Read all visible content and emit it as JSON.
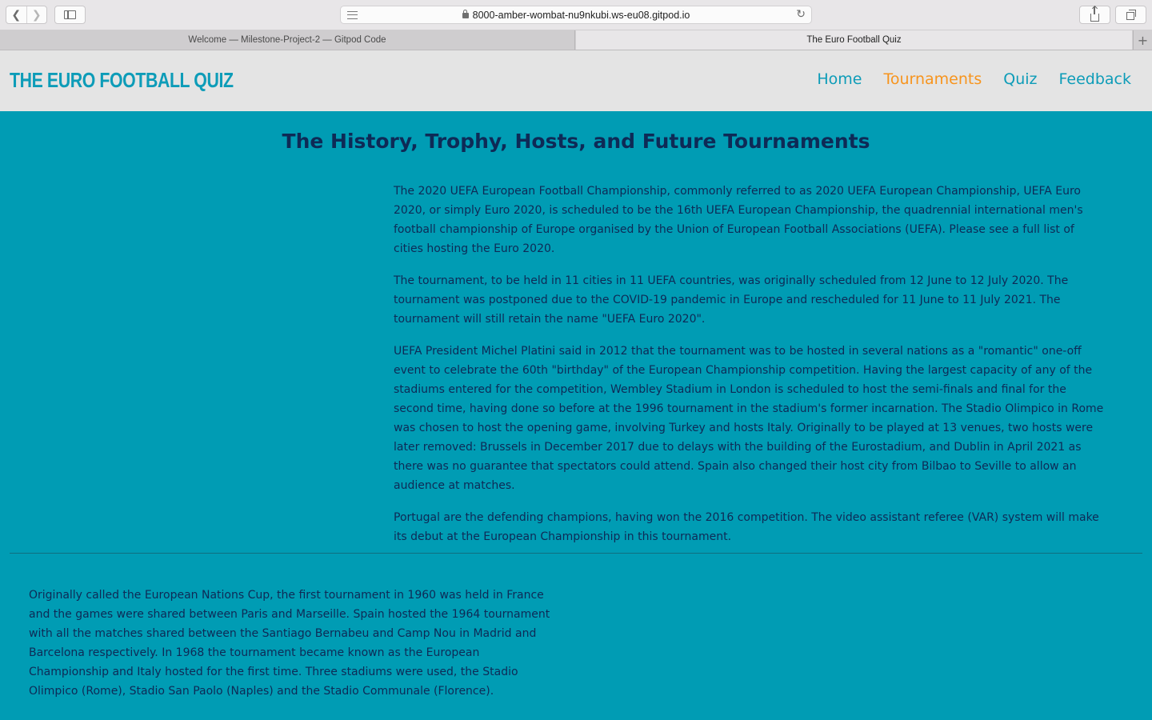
{
  "browser": {
    "url": "8000-amber-wombat-nu9nkubi.ws-eu08.gitpod.io",
    "tabs": [
      {
        "label": "Welcome — Milestone-Project-2 — Gitpod Code"
      },
      {
        "label": "The Euro Football Quiz"
      }
    ],
    "icons": [
      "back-icon",
      "forward-icon",
      "sidebar-icon",
      "reader-icon",
      "lock-icon",
      "reload-icon",
      "share-icon",
      "tabs-overview-icon",
      "new-tab-icon"
    ]
  },
  "site": {
    "brand": "THE EURO FOOTBALL QUIZ",
    "nav": [
      {
        "label": "Home",
        "active": false
      },
      {
        "label": "Tournaments",
        "active": true
      },
      {
        "label": "Quiz",
        "active": false
      },
      {
        "label": "Feedback",
        "active": false
      }
    ],
    "colors": {
      "background": "#009cb4",
      "header": "#e4e4e4",
      "brand": "#0d9cb8",
      "active_nav": "#f7941d",
      "text": "#0e2a56"
    }
  },
  "main": {
    "heading": "The History, Trophy, Hosts, and Future Tournaments",
    "section1": [
      "The 2020 UEFA European Football Championship, commonly referred to as 2020 UEFA European Championship, UEFA Euro 2020, or simply Euro 2020, is scheduled to be the 16th UEFA European Championship, the quadrennial international men's football championship of Europe organised by the Union of European Football Associations (UEFA). Please see a full list of cities hosting the Euro 2020.",
      "The tournament, to be held in 11 cities in 11 UEFA countries, was originally scheduled from 12 June to 12 July 2020. The tournament was postponed due to the COVID-19 pandemic in Europe and rescheduled for 11 June to 11 July 2021. The tournament will still retain the name \"UEFA Euro 2020\".",
      "UEFA President Michel Platini said in 2012 that the tournament was to be hosted in several nations as a \"romantic\" one-off event to celebrate the 60th \"birthday\" of the European Championship competition. Having the largest capacity of any of the stadiums entered for the competition, Wembley Stadium in London is scheduled to host the semi-finals and final for the second time, having done so before at the 1996 tournament in the stadium's former incarnation. The Stadio Olimpico in Rome was chosen to host the opening game, involving Turkey and hosts Italy. Originally to be played at 13 venues, two hosts were later removed: Brussels in December 2017 due to delays with the building of the Eurostadium, and Dublin in April 2021 as there was no guarantee that spectators could attend. Spain also changed their host city from Bilbao to Seville to allow an audience at matches.",
      "Portugal are the defending champions, having won the 2016 competition. The video assistant referee (VAR) system will make its debut at the European Championship in this tournament."
    ],
    "section2": [
      "Originally called the European Nations Cup, the first tournament in 1960 was held in France and the games were shared between Paris and Marseille. Spain hosted the 1964 tournament with all the matches shared between the Santiago Bernabeu and Camp Nou in Madrid and Barcelona respectively. In 1968 the tournament became known as the European Championship and Italy hosted for the first time. Three stadiums were used, the Stadio Olimpico (Rome), Stadio San Paolo (Naples) and the Stadio Communale (Florence)."
    ]
  }
}
